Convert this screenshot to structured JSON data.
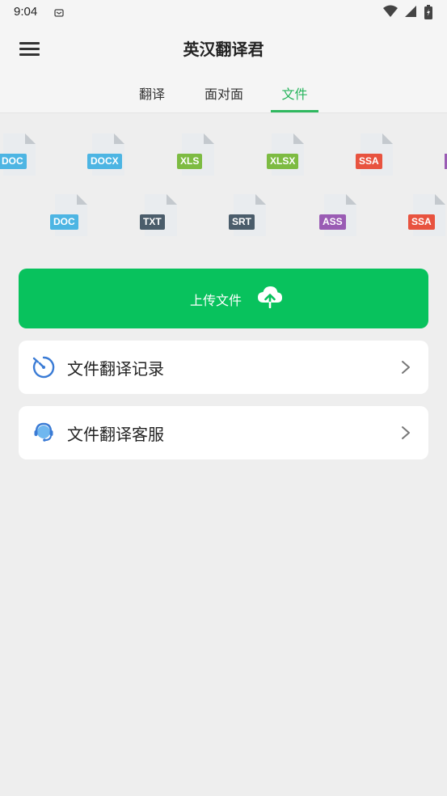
{
  "status_bar": {
    "time": "9:04",
    "icons": [
      "notification-icon",
      "wifi-icon",
      "signal-icon",
      "battery-icon"
    ]
  },
  "header": {
    "title": "英汉翻译君",
    "menu_icon": "menu-icon"
  },
  "tabs": [
    {
      "label": "翻译",
      "active": false
    },
    {
      "label": "面对面",
      "active": false
    },
    {
      "label": "文件",
      "active": true
    }
  ],
  "file_types_row1": [
    {
      "label": "DOC",
      "color": "#4db5e3"
    },
    {
      "label": "DOCX",
      "color": "#4db5e3"
    },
    {
      "label": "XLS",
      "color": "#7dbb42"
    },
    {
      "label": "XLSX",
      "color": "#7dbb42"
    },
    {
      "label": "SSA",
      "color": "#e8533f"
    }
  ],
  "file_types_row2": [
    {
      "label": "DOC",
      "color": "#4db5e3"
    },
    {
      "label": "TXT",
      "color": "#4b5d6b"
    },
    {
      "label": "SRT",
      "color": "#4b5d6b"
    },
    {
      "label": "ASS",
      "color": "#9a5cb4"
    },
    {
      "label": "SSA",
      "color": "#e8533f"
    }
  ],
  "upload": {
    "label": "上传文件",
    "icon": "cloud-upload-icon",
    "color": "#08c25d"
  },
  "menu_items": [
    {
      "label": "文件翻译记录",
      "icon": "timer-icon"
    },
    {
      "label": "文件翻译客服",
      "icon": "customer-service-icon"
    }
  ],
  "colors": {
    "accent": "#27b45c",
    "background": "#eeeeee"
  }
}
